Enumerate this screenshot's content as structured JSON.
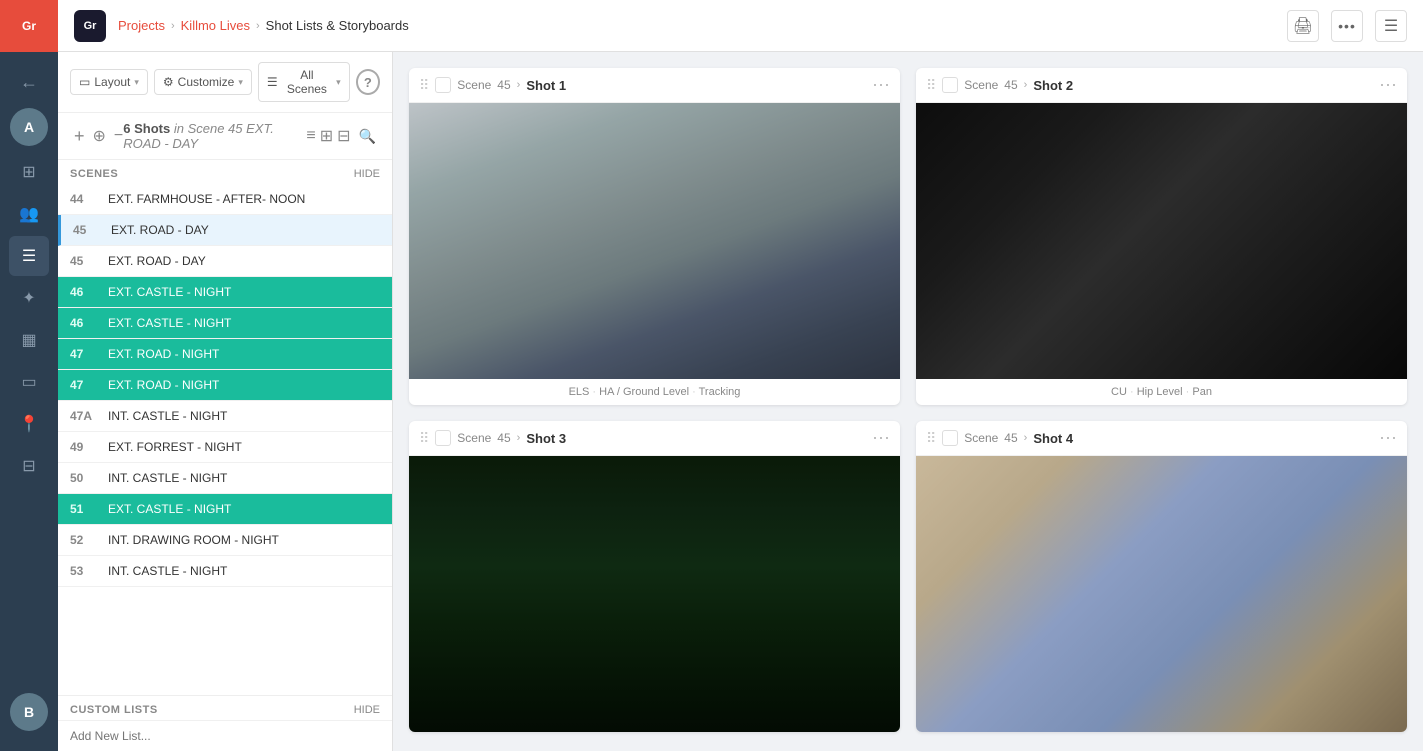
{
  "app": {
    "logo_text": "Gr",
    "icon_bar": {
      "icons": [
        {
          "name": "back-icon",
          "symbol": "←"
        },
        {
          "name": "avatar-icon",
          "symbol": "👤"
        },
        {
          "name": "layers-icon",
          "symbol": "⊞"
        },
        {
          "name": "person-icon",
          "symbol": "👥"
        },
        {
          "name": "list-icon",
          "symbol": "☰"
        },
        {
          "name": "globe-icon",
          "symbol": "✦"
        },
        {
          "name": "calendar-icon",
          "symbol": "📅"
        },
        {
          "name": "document-icon",
          "symbol": "▭"
        },
        {
          "name": "pin-icon",
          "symbol": "📍"
        },
        {
          "name": "sliders-icon",
          "symbol": "⊟"
        },
        {
          "name": "bottom-avatar-icon",
          "symbol": "👤"
        }
      ]
    }
  },
  "topbar": {
    "breadcrumb": {
      "projects_label": "Projects",
      "killmo_label": "Killmo Lives",
      "current_label": "Shot Lists & Storyboards"
    },
    "print_icon": "🖨",
    "more_icon": "•••",
    "menu_icon": "☰"
  },
  "toolbar": {
    "layout_label": "Layout",
    "customize_label": "Customize",
    "all_scenes_label": "All Scenes",
    "help_label": "?",
    "shot_count_text": "6 Shots",
    "shot_scene_text": "in Scene 45 EXT. ROAD - DAY",
    "add_icon": "+",
    "zoom_in_icon": "⊕",
    "zoom_out_icon": "−",
    "view_list_icon": "≡",
    "view_grid2_icon": "⊞",
    "view_grid3_icon": "⊟",
    "search_icon": "🔍"
  },
  "sidebar": {
    "scenes_title": "SCENES",
    "hide_label": "HIDE",
    "custom_lists_title": "CUSTOM LISTS",
    "custom_lists_hide": "HIDE",
    "add_list_placeholder": "Add New List...",
    "scenes": [
      {
        "num": "44",
        "name": "EXT. FARMHOUSE - AFTER- NOON",
        "style": "normal"
      },
      {
        "num": "45",
        "name": "EXT. ROAD - DAY",
        "style": "active"
      },
      {
        "num": "45",
        "name": "EXT. ROAD - DAY",
        "style": "normal"
      },
      {
        "num": "46",
        "name": "EXT. CASTLE - NIGHT",
        "style": "teal"
      },
      {
        "num": "46",
        "name": "EXT. CASTLE - NIGHT",
        "style": "teal"
      },
      {
        "num": "47",
        "name": "EXT. ROAD - NIGHT",
        "style": "teal"
      },
      {
        "num": "47",
        "name": "EXT. ROAD - NIGHT",
        "style": "teal"
      },
      {
        "num": "47A",
        "name": "INT. CASTLE - NIGHT",
        "style": "normal"
      },
      {
        "num": "49",
        "name": "EXT. FORREST - NIGHT",
        "style": "normal"
      },
      {
        "num": "50",
        "name": "INT. CASTLE - NIGHT",
        "style": "normal"
      },
      {
        "num": "51",
        "name": "EXT. CASTLE - NIGHT",
        "style": "teal"
      },
      {
        "num": "52",
        "name": "INT. DRAWING ROOM - NIGHT",
        "style": "normal"
      },
      {
        "num": "53",
        "name": "INT. CASTLE - NIGHT",
        "style": "normal"
      }
    ]
  },
  "shots": [
    {
      "scene_num": "45",
      "shot_num": "Shot 1",
      "image_type": "road",
      "tags": [
        "ELS",
        "HA / Ground Level",
        "Tracking"
      ]
    },
    {
      "scene_num": "45",
      "shot_num": "Shot 2",
      "image_type": "steering",
      "tags": [
        "CU",
        "Hip Level",
        "Pan"
      ]
    },
    {
      "scene_num": "45",
      "shot_num": "Shot 3",
      "image_type": "forest",
      "tags": []
    },
    {
      "scene_num": "45",
      "shot_num": "Shot 4",
      "image_type": "mountain",
      "tags": []
    }
  ]
}
